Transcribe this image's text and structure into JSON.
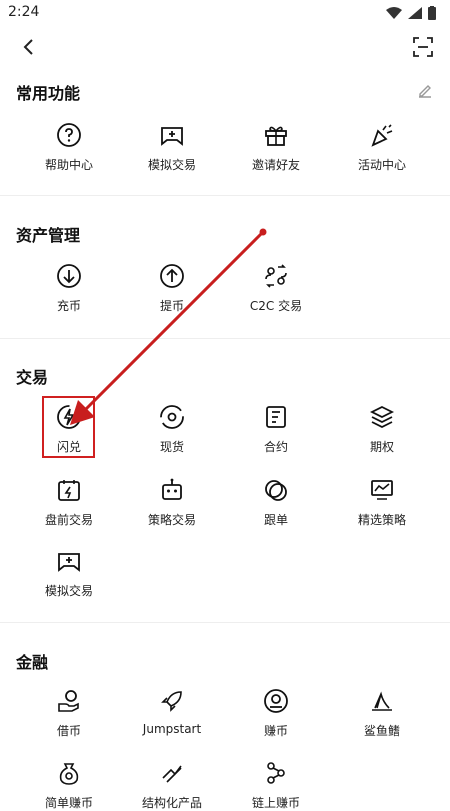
{
  "status": {
    "time": "2:24"
  },
  "sections": {
    "common": {
      "title": "常用功能",
      "items": [
        "帮助中心",
        "模拟交易",
        "邀请好友",
        "活动中心"
      ]
    },
    "assets": {
      "title": "资产管理",
      "items": [
        "充币",
        "提币",
        "C2C 交易"
      ]
    },
    "trade": {
      "title": "交易",
      "items": [
        "闪兑",
        "现货",
        "合约",
        "期权",
        "盘前交易",
        "策略交易",
        "跟单",
        "精选策略",
        "模拟交易"
      ]
    },
    "finance": {
      "title": "金融",
      "items": [
        "借币",
        "Jumpstart",
        "赚币",
        "鲨鱼鳍",
        "简单赚币",
        "结构化产品",
        "链上赚币"
      ]
    }
  },
  "icons": {
    "common": [
      "help-icon",
      "simulated-trade-icon",
      "gift-icon",
      "party-popper-icon"
    ],
    "assets": [
      "deposit-icon",
      "withdraw-icon",
      "c2c-icon"
    ],
    "trade": [
      "flash-exchange-icon",
      "spot-icon",
      "contract-icon",
      "options-icon",
      "pre-market-icon",
      "strategy-bot-icon",
      "copy-trade-icon",
      "selected-strategy-icon",
      "simulated-trade-icon"
    ],
    "finance": [
      "borrow-icon",
      "jumpstart-rocket-icon",
      "earn-icon",
      "shark-fin-icon",
      "simple-earn-icon",
      "structured-product-icon",
      "onchain-earn-icon"
    ]
  },
  "annotation": {
    "color": "#d02020"
  }
}
